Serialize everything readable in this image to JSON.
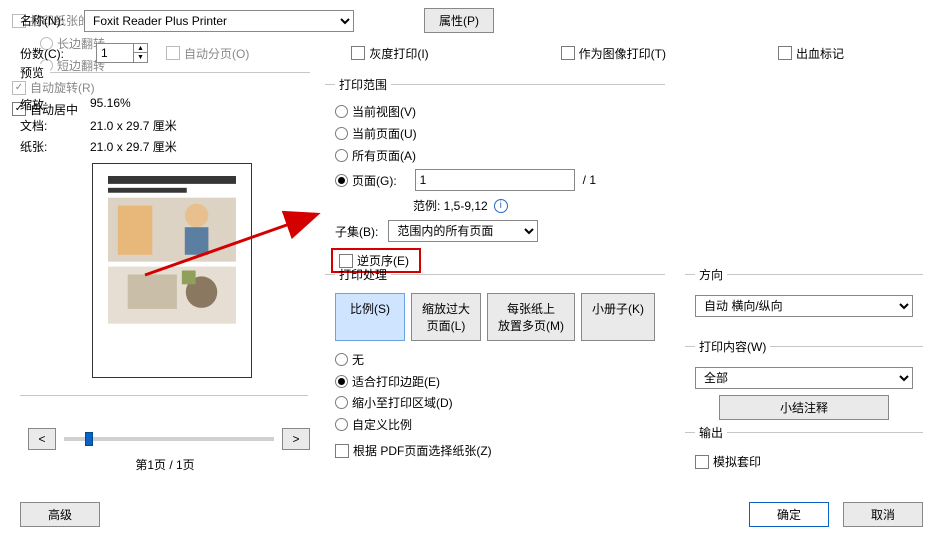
{
  "top": {
    "name_label": "名称(N):",
    "printer": "Foxit Reader Plus Printer",
    "properties_btn": "属性(P)",
    "copies_label": "份数(C):",
    "copies_value": "1",
    "collate_label": "自动分页(O)",
    "grayscale_label": "灰度打印(I)",
    "as_image_label": "作为图像打印(T)",
    "bleed_label": "出血标记"
  },
  "preview": {
    "legend": "预览",
    "zoom_label": "缩放:",
    "zoom_value": "95.16%",
    "doc_label": "文档:",
    "doc_value": "21.0 x 29.7 厘米",
    "paper_label": "纸张:",
    "paper_value": "21.0 x 29.7 厘米",
    "page_indicator": "第1页 / 1页"
  },
  "range": {
    "legend": "打印范围",
    "current_view": "当前视图(V)",
    "current_page": "当前页面(U)",
    "all_pages": "所有页面(A)",
    "pages": "页面(G):",
    "pages_value": "1",
    "pages_total": "/ 1",
    "example_label": "范例:  1,5-9,12",
    "subset_label": "子集(B):",
    "subset_value": "范围内的所有页面",
    "reverse_label": "逆页序(E)"
  },
  "handling": {
    "legend": "打印处理",
    "tab_scale": "比例(S)",
    "tab_big_l1": "缩放过大",
    "tab_big_l2": "页面(L)",
    "tab_multi_l1": "每张纸上",
    "tab_multi_l2": "放置多页(M)",
    "tab_booklet": "小册子(K)",
    "none": "无",
    "fit": "适合打印边距(E)",
    "shrink": "缩小至打印区域(D)",
    "custom": "自定义比例",
    "choose_paper": "根据 PDF页面选择纸张(Z)"
  },
  "duplex": {
    "both_sides": "打印纸张的两面",
    "long_edge": "长边翻转",
    "short_edge": "短边翻转",
    "auto_rotate": "自动旋转(R)",
    "auto_center": "自动居中"
  },
  "orient": {
    "legend": "方向",
    "value": "自动 横向/纵向"
  },
  "content": {
    "legend": "打印内容(W)",
    "value": "全部",
    "summary_btn": "小结注释"
  },
  "output": {
    "legend": "输出",
    "simulate": "模拟套印"
  },
  "footer": {
    "advanced": "高级",
    "ok": "确定",
    "cancel": "取消"
  }
}
